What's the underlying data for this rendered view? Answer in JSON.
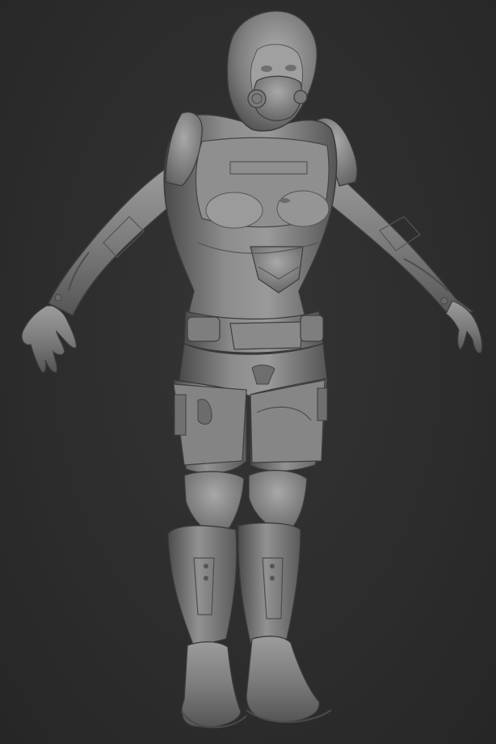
{
  "scene": {
    "description_type": "3d-sculpt-render",
    "subject": "armored-female-character-t-pose",
    "background_color": "#2c2c2c",
    "material_color": "#8a8a8a",
    "highlight_color": "#c8c8c8",
    "shadow_color": "#3a3a3a"
  }
}
